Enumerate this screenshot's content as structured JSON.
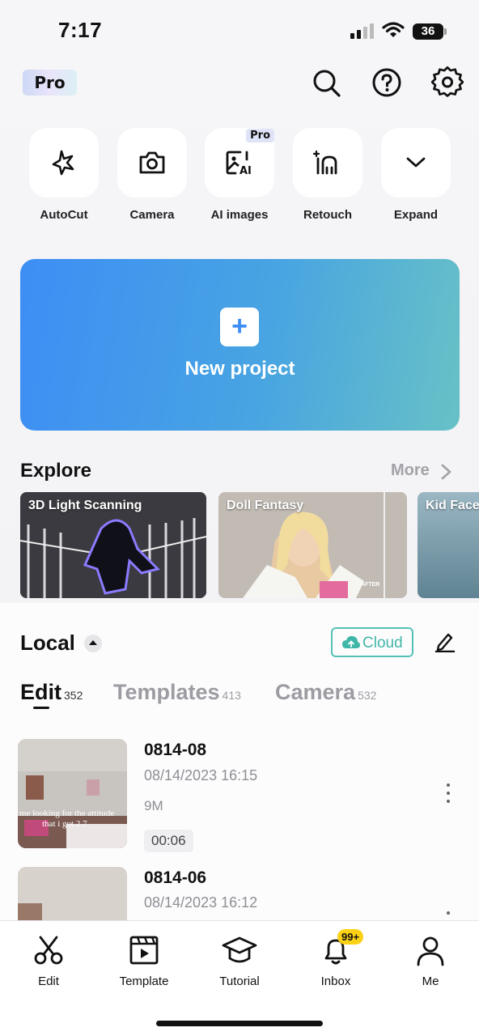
{
  "status_bar": {
    "time": "7:17",
    "battery": "36"
  },
  "header": {
    "pro_badge": "Pro",
    "icons": [
      "search-icon",
      "help-icon",
      "settings-icon"
    ]
  },
  "quick_actions": [
    {
      "label": "AutoCut",
      "icon": "autocut-icon"
    },
    {
      "label": "Camera",
      "icon": "camera-icon"
    },
    {
      "label": "AI images",
      "icon": "ai-image-icon",
      "badge": "Pro"
    },
    {
      "label": "Retouch",
      "icon": "retouch-icon"
    },
    {
      "label": "Expand",
      "icon": "chevron-down-icon"
    }
  ],
  "new_project": {
    "label": "New project",
    "plus": "+"
  },
  "explore": {
    "title": "Explore",
    "more_label": "More",
    "cards": [
      {
        "title": "3D Light Scanning"
      },
      {
        "title": "Doll Fantasy"
      },
      {
        "title": "Kid Face"
      }
    ]
  },
  "local": {
    "title": "Local",
    "cloud_label": "Cloud",
    "tabs": [
      {
        "label": "Edit",
        "count": "352"
      },
      {
        "label": "Templates",
        "count": "413"
      },
      {
        "label": "Camera",
        "count": "532"
      }
    ],
    "projects": [
      {
        "name": "0814-08",
        "date": "08/14/2023 16:15",
        "size": "9M",
        "duration": "00:06",
        "caption": "me looking for the attitude that i got 2 7 "
      },
      {
        "name": "0814-06",
        "date": "08/14/2023 16:12"
      }
    ]
  },
  "bottom_nav": [
    {
      "label": "Edit",
      "icon": "scissors-icon"
    },
    {
      "label": "Template",
      "icon": "template-icon"
    },
    {
      "label": "Tutorial",
      "icon": "graduation-cap-icon"
    },
    {
      "label": "Inbox",
      "icon": "bell-icon",
      "badge": "99+"
    },
    {
      "label": "Me",
      "icon": "profile-icon"
    }
  ],
  "colors": {
    "accent_blue": "#3d8ef5",
    "cloud_teal": "#3fb7a8",
    "badge_yellow": "#fbd116"
  }
}
